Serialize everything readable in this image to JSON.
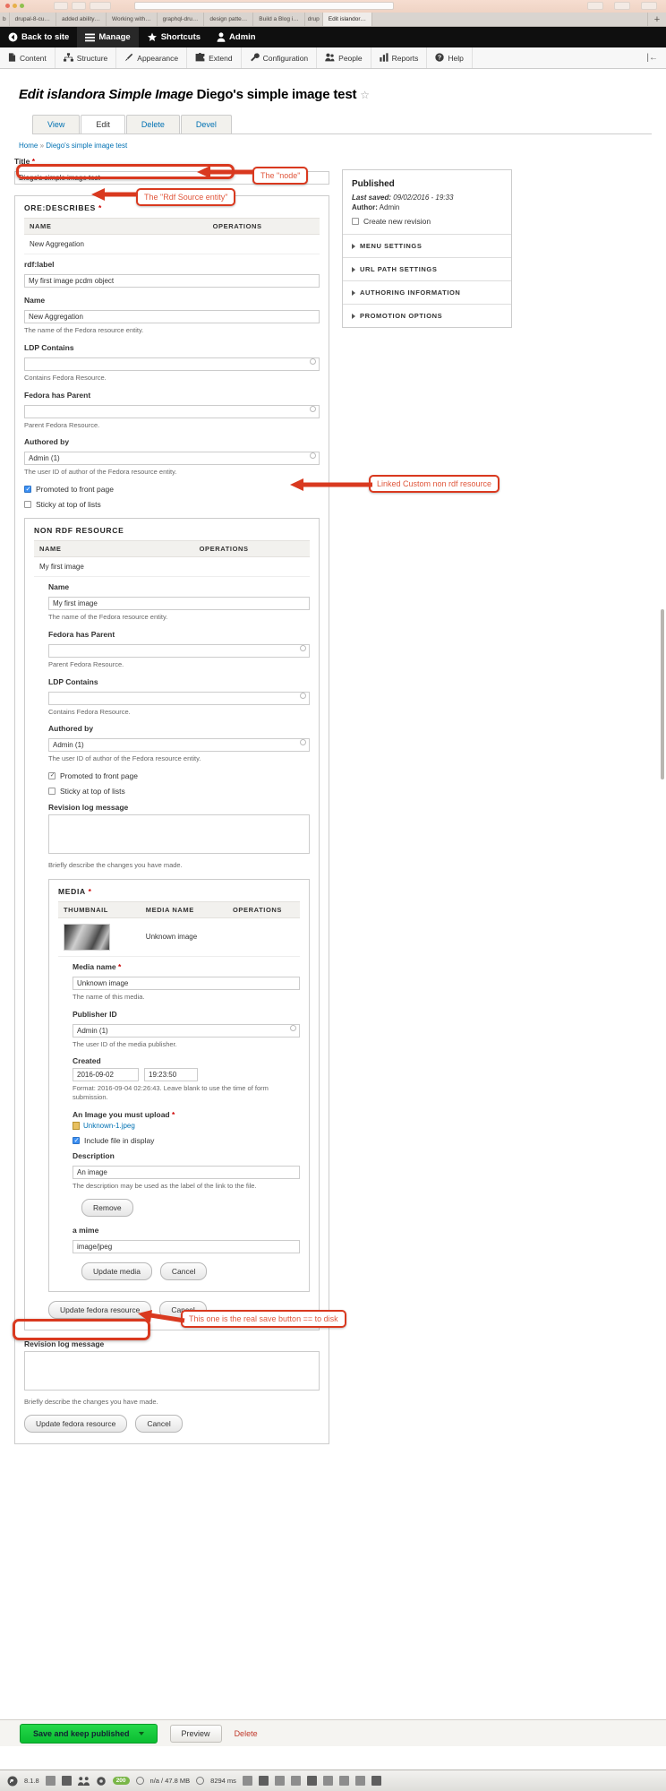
{
  "browser": {
    "tabs": [
      {
        "label": "b",
        "active": false
      },
      {
        "label": "drupal-8-cu…",
        "active": false
      },
      {
        "label": "added ability…",
        "active": false
      },
      {
        "label": "Working with…",
        "active": false
      },
      {
        "label": "graphql-dru…",
        "active": false
      },
      {
        "label": "design patte…",
        "active": false
      },
      {
        "label": "Build a Blog i…",
        "active": false
      },
      {
        "label": "drup",
        "active": false
      },
      {
        "label": "Edit islandor…",
        "active": true
      }
    ],
    "new_tab_label": "+"
  },
  "admin_toolbar": {
    "items": [
      {
        "label": "Back to site",
        "icon": "back-arrow-icon",
        "active": false
      },
      {
        "label": "Manage",
        "icon": "hamburger-icon",
        "active": true
      },
      {
        "label": "Shortcuts",
        "icon": "star-icon",
        "active": false
      },
      {
        "label": "Admin",
        "icon": "user-icon",
        "active": false
      }
    ]
  },
  "admin_menu": {
    "items": [
      {
        "label": "Content",
        "icon": "document-icon"
      },
      {
        "label": "Structure",
        "icon": "structure-icon"
      },
      {
        "label": "Appearance",
        "icon": "brush-icon"
      },
      {
        "label": "Extend",
        "icon": "puzzle-icon"
      },
      {
        "label": "Configuration",
        "icon": "wrench-icon"
      },
      {
        "label": "People",
        "icon": "people-icon"
      },
      {
        "label": "Reports",
        "icon": "bar-chart-icon"
      },
      {
        "label": "Help",
        "icon": "question-icon"
      }
    ],
    "collapse_label": "|←"
  },
  "page": {
    "title_prefix": "Edit islandora Simple Image",
    "title_name": "Diego's simple image test",
    "title_star": "☆",
    "tabs": [
      {
        "label": "View",
        "active": false
      },
      {
        "label": "Edit",
        "active": true
      },
      {
        "label": "Delete",
        "active": false
      },
      {
        "label": "Devel",
        "active": false
      }
    ],
    "breadcrumb": {
      "home": "Home",
      "separator": "»",
      "current": "Diego's simple image test"
    }
  },
  "form": {
    "title_label": "Title",
    "title_required": "*",
    "title_value": "Diego's simple image test",
    "ore_describes": {
      "legend": "ORE:DESCRIBES",
      "required": "*",
      "table": {
        "headers": [
          "NAME",
          "OPERATIONS"
        ],
        "rows": [
          {
            "name": "New Aggregation",
            "operations": ""
          }
        ]
      },
      "rdflabel_label": "rdf:label",
      "rdflabel_value": "My first image pcdm object",
      "name_label": "Name",
      "name_value": "New Aggregation",
      "name_desc": "The name of the Fedora resource entity.",
      "ldp_label": "LDP Contains",
      "ldp_value": "",
      "ldp_desc": "Contains Fedora Resource.",
      "parent_label": "Fedora has Parent",
      "parent_value": "",
      "parent_desc": "Parent Fedora Resource.",
      "authored_label": "Authored by",
      "authored_value": "Admin (1)",
      "authored_desc": "The user ID of author of the Fedora resource entity.",
      "promoted_label": "Promoted to front page",
      "promoted_checked": true,
      "sticky_label": "Sticky at top of lists",
      "sticky_checked": false
    },
    "non_rdf_resource": {
      "legend": "NON RDF RESOURCE",
      "table": {
        "headers": [
          "NAME",
          "OPERATIONS"
        ],
        "rows": [
          {
            "name": "My first image",
            "operations": ""
          }
        ]
      },
      "name_label": "Name",
      "name_value": "My first image",
      "name_desc": "The name of the Fedora resource entity.",
      "parent_label": "Fedora has Parent",
      "parent_value": "",
      "parent_desc": "Parent Fedora Resource.",
      "ldp_label": "LDP Contains",
      "ldp_value": "",
      "ldp_desc": "Contains Fedora Resource.",
      "authored_label": "Authored by",
      "authored_value": "Admin (1)",
      "authored_desc": "The user ID of author of the Fedora resource entity.",
      "promoted_label": "Promoted to front page",
      "promoted_checked": true,
      "sticky_label": "Sticky at top of lists",
      "sticky_checked": false,
      "revlog_label": "Revision log message",
      "revlog_value": "",
      "revlog_desc": "Briefly describe the changes you have made.",
      "update_button": "Update fedora resource",
      "cancel_button": "Cancel"
    },
    "media": {
      "legend": "MEDIA",
      "required": "*",
      "table": {
        "headers": [
          "THUMBNAIL",
          "MEDIA NAME",
          "OPERATIONS"
        ],
        "rows": [
          {
            "thumbnail": "baby-photo-thumbnail",
            "media_name": "Unknown image",
            "operations": ""
          }
        ]
      },
      "media_name_label": "Media name",
      "media_name_required": "*",
      "media_name_value": "Unknown image",
      "media_name_desc": "The name of this media.",
      "publisher_label": "Publisher ID",
      "publisher_value": "Admin (1)",
      "publisher_desc": "The user ID of the media publisher.",
      "created_label": "Created",
      "created_date": "2016-09-02",
      "created_time": "19:23:50",
      "created_desc": "Format: 2016-09-04 02:26:43. Leave blank to use the time of form submission.",
      "upload_label": "An Image you must upload",
      "upload_required": "*",
      "upload_file": "Unknown-1.jpeg",
      "include_label": "Include file in display",
      "include_checked": true,
      "description_label": "Description",
      "description_value": "An image",
      "description_desc": "The description may be used as the label of the link to the file.",
      "remove_button": "Remove",
      "mime_label": "a mime",
      "mime_value": "image/jpeg",
      "update_media_button": "Update media",
      "cancel_button": "Cancel"
    },
    "outer_update_button": "Update fedora resource",
    "outer_cancel_button": "Cancel",
    "bottom_revlog_label": "Revision log message",
    "bottom_revlog_value": "",
    "bottom_revlog_desc": "Briefly describe the changes you have made.",
    "bottom_update_button": "Update fedora resource",
    "bottom_cancel_button": "Cancel"
  },
  "sidebar": {
    "status": "Published",
    "last_saved_label": "Last saved:",
    "last_saved_value": "09/02/2016 - 19:33",
    "author_label": "Author:",
    "author_value": "Admin",
    "new_revision_label": "Create new revision",
    "new_revision_checked": false,
    "sections": [
      {
        "label": "MENU SETTINGS"
      },
      {
        "label": "URL PATH SETTINGS"
      },
      {
        "label": "AUTHORING INFORMATION"
      },
      {
        "label": "PROMOTION OPTIONS"
      }
    ]
  },
  "save_bar": {
    "save_label": "Save and keep published",
    "preview_label": "Preview",
    "delete_label": "Delete"
  },
  "annotations": [
    {
      "id": "node",
      "text": "The \"node\""
    },
    {
      "id": "rdf-source",
      "text": "The \"Rdf Source entity\""
    },
    {
      "id": "linked-custom",
      "text": "Linked Custom non rdf resource"
    },
    {
      "id": "real-save",
      "text": "This one is the real save button == to disk"
    }
  ],
  "status_bar": {
    "php_version": "8.1.8",
    "memory_badge": "200",
    "memory": "n/a / 47.8 MB",
    "time": "8294 ms",
    "icons": [
      "list-icon",
      "image-icon",
      "grid-icon",
      "table-icon",
      "columns-icon",
      "trash-icon",
      "arrow-icon",
      "pin-icon",
      "db-icon"
    ]
  },
  "colors": {
    "annotation_red": "#d9391f",
    "annotation_text": "#e0573c",
    "save_green": "#0bbd31",
    "link_blue": "#0071b3",
    "toolbar_black": "#0f0f0f"
  }
}
